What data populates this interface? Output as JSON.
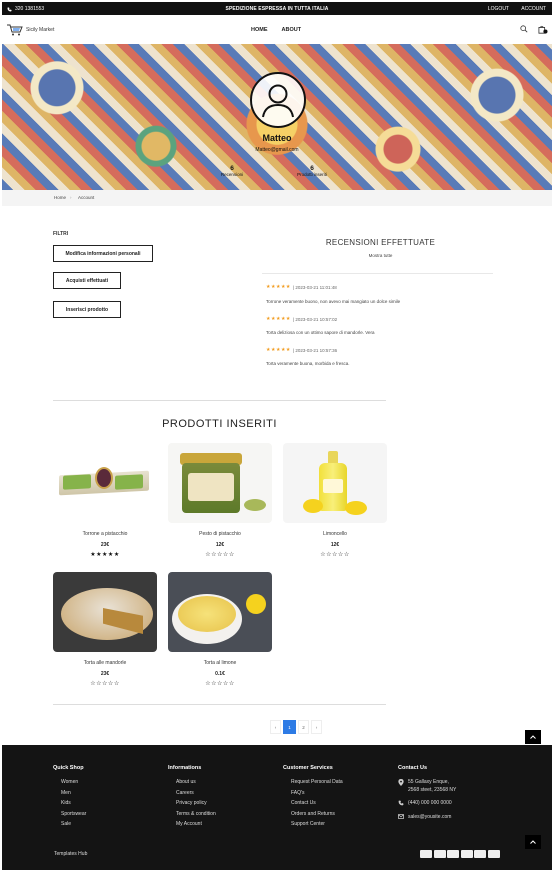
{
  "topbar": {
    "phone": "320 1381553",
    "promo": "SPEDIZIONE ESPRESSA IN TUTTA ITALIA",
    "logout": "LOGOUT",
    "account": "ACCOUNT"
  },
  "header": {
    "brand": "Sicily Market",
    "nav": [
      "HOME",
      "ABOUT"
    ]
  },
  "profile": {
    "name": "Matteo",
    "email": "Matteo@gmail.com",
    "stats": [
      {
        "value": "6",
        "label": "Recensioni"
      },
      {
        "value": "6",
        "label": "Prodotti inseriti"
      }
    ]
  },
  "breadcrumb": [
    "Home",
    "Account"
  ],
  "filters": {
    "title": "FILTRI",
    "buttons": [
      "Modifica informazioni personali",
      "Acquisti effettuati",
      "Inserisci prodotto"
    ]
  },
  "reviews": {
    "title": "RECENSIONI EFFETTUATE",
    "show_all": "Mostra tutte",
    "items": [
      {
        "stars": "★★★★★",
        "date": "| 2023-03-21 11:01:48",
        "text": "Torrone veramente buono, non avevo mai mangiato un dolce simile"
      },
      {
        "stars": "★★★★★",
        "date": "| 2023-03-21 10:57:02",
        "text": "Torta deliziosa con un ottimo sapore di mandorle. Vera"
      },
      {
        "stars": "★★★★★",
        "date": "| 2023-03-21 10:57:36",
        "text": "Torta veramente buona, morbida e fresca."
      }
    ]
  },
  "products": {
    "title": "PRODOTTI INSERITI",
    "items": [
      {
        "name": "Torrone a pistacchio",
        "price": "23€",
        "rating": "★★★★★"
      },
      {
        "name": "Pesto di pistacchio",
        "price": "12€",
        "rating": "☆☆☆☆☆"
      },
      {
        "name": "Limoncello",
        "price": "12€",
        "rating": "☆☆☆☆☆"
      },
      {
        "name": "Torta alle mandorle",
        "price": "23€",
        "rating": "☆☆☆☆☆"
      },
      {
        "name": "Torta al limone",
        "price": "0.1€",
        "rating": "☆☆☆☆☆"
      }
    ]
  },
  "pagination": {
    "prev": "‹",
    "pages": [
      "1",
      "2"
    ],
    "next": "›",
    "current": "1"
  },
  "footer": {
    "quick_shop": {
      "title": "Quick Shop",
      "items": [
        "Women",
        "Men",
        "Kids",
        "Sportswear",
        "Sale"
      ]
    },
    "informations": {
      "title": "Informations",
      "items": [
        "About us",
        "Careers",
        "Privacy policy",
        "Terms & condition",
        "My Account"
      ]
    },
    "customer_services": {
      "title": "Customer Services",
      "items": [
        "Request Personal Data",
        "FAQ's",
        "Contact Us",
        "Orders and Returns",
        "Support Center"
      ]
    },
    "contact": {
      "title": "Contact Us",
      "address_line1": "55 Gallaxy Enque,",
      "address_line2": "2568 steet, 23568 NY",
      "phone": "(440) 000 000 0000",
      "email": "sales@yousite.com"
    },
    "copyright": "Templates Hub"
  },
  "colors": {
    "accent": "#2d7be5",
    "star": "#f29c1f",
    "dark": "#141414"
  }
}
